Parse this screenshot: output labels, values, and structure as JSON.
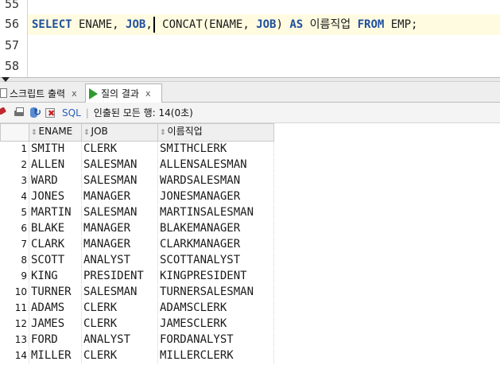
{
  "editor": {
    "line_numbers": [
      "55",
      "56",
      "57",
      "58"
    ],
    "code_tokens": [
      {
        "text": "SELECT",
        "kind": "kw"
      },
      {
        "text": " ENAME, ",
        "kind": "plain"
      },
      {
        "text": "JOB",
        "kind": "kw"
      },
      {
        "text": ",",
        "kind": "plain"
      },
      {
        "text": "",
        "kind": "caret"
      },
      {
        "text": " CONCAT(ENAME, ",
        "kind": "plain"
      },
      {
        "text": "JOB",
        "kind": "kw"
      },
      {
        "text": ") ",
        "kind": "plain"
      },
      {
        "text": "AS",
        "kind": "kw"
      },
      {
        "text": " 이름직업 ",
        "kind": "plain"
      },
      {
        "text": "FROM",
        "kind": "kw"
      },
      {
        "text": " EMP;",
        "kind": "plain"
      }
    ]
  },
  "tabs": {
    "script_output": "스크립트 출력",
    "query_result": "질의 결과",
    "close_glyph": "x"
  },
  "toolbar": {
    "sql_label": "SQL",
    "separator": "|",
    "status": "인출된 모든 행: 14(0초)"
  },
  "grid": {
    "sort_glyph": "⇕",
    "columns": [
      "ENAME",
      "JOB",
      "이름직업"
    ],
    "rows": [
      {
        "n": "1",
        "ename": "SMITH",
        "job": "CLERK",
        "name_job": "SMITHCLERK"
      },
      {
        "n": "2",
        "ename": "ALLEN",
        "job": "SALESMAN",
        "name_job": "ALLENSALESMAN"
      },
      {
        "n": "3",
        "ename": "WARD",
        "job": "SALESMAN",
        "name_job": "WARDSALESMAN"
      },
      {
        "n": "4",
        "ename": "JONES",
        "job": "MANAGER",
        "name_job": "JONESMANAGER"
      },
      {
        "n": "5",
        "ename": "MARTIN",
        "job": "SALESMAN",
        "name_job": "MARTINSALESMAN"
      },
      {
        "n": "6",
        "ename": "BLAKE",
        "job": "MANAGER",
        "name_job": "BLAKEMANAGER"
      },
      {
        "n": "7",
        "ename": "CLARK",
        "job": "MANAGER",
        "name_job": "CLARKMANAGER"
      },
      {
        "n": "8",
        "ename": "SCOTT",
        "job": "ANALYST",
        "name_job": "SCOTTANALYST"
      },
      {
        "n": "9",
        "ename": "KING",
        "job": "PRESIDENT",
        "name_job": "KINGPRESIDENT"
      },
      {
        "n": "10",
        "ename": "TURNER",
        "job": "SALESMAN",
        "name_job": "TURNERSALESMAN"
      },
      {
        "n": "11",
        "ename": "ADAMS",
        "job": "CLERK",
        "name_job": "ADAMSCLERK"
      },
      {
        "n": "12",
        "ename": "JAMES",
        "job": "CLERK",
        "name_job": "JAMESCLERK"
      },
      {
        "n": "13",
        "ename": "FORD",
        "job": "ANALYST",
        "name_job": "FORDANALYST"
      },
      {
        "n": "14",
        "ename": "MILLER",
        "job": "CLERK",
        "name_job": "MILLERCLERK"
      }
    ]
  }
}
